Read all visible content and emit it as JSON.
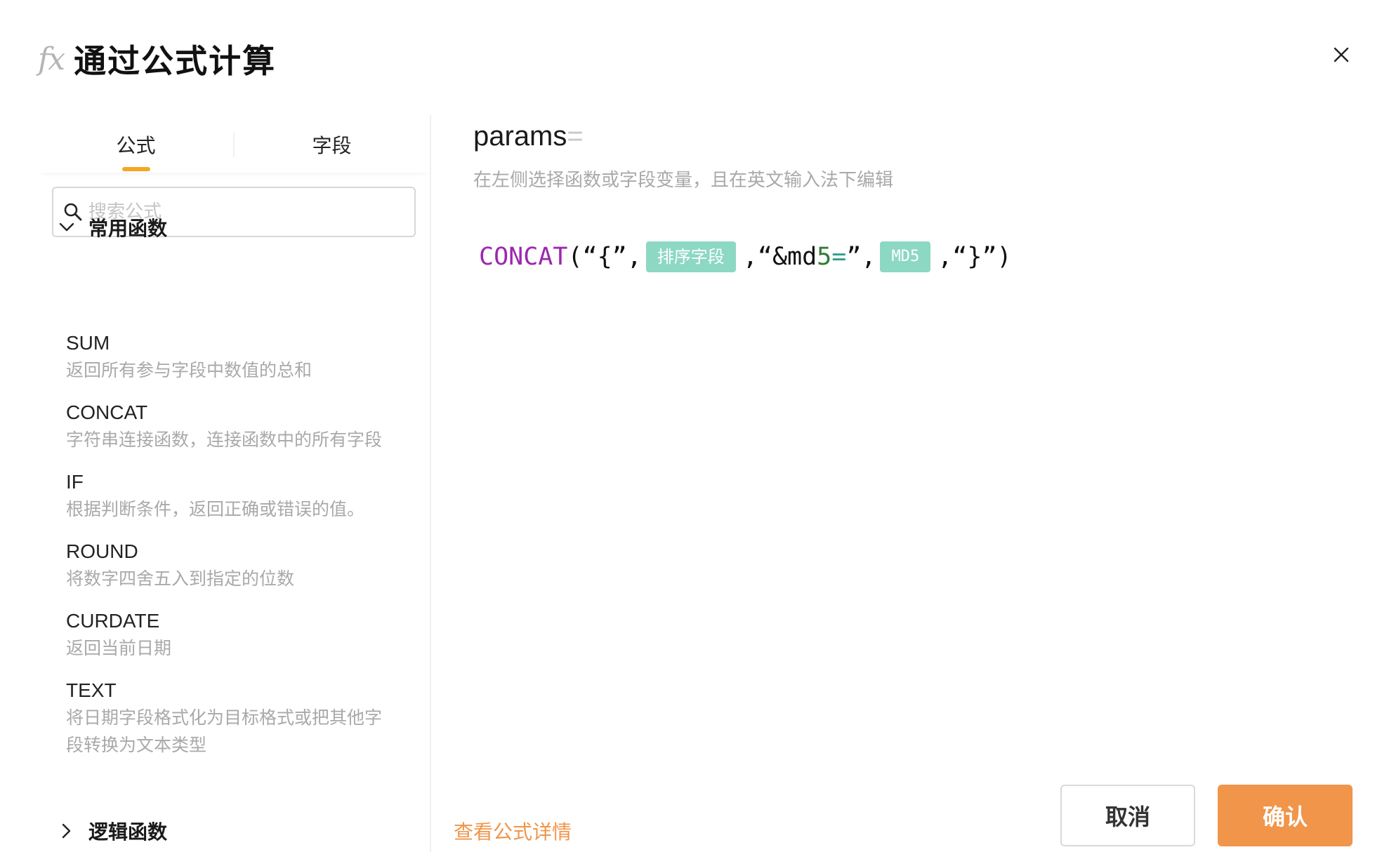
{
  "header": {
    "fx_glyph": "fx",
    "title": "通过公式计算",
    "close_icon": "close-icon"
  },
  "tabs": [
    {
      "label": "公式",
      "active": true
    },
    {
      "label": "字段",
      "active": false
    }
  ],
  "search": {
    "placeholder": "搜索公式",
    "value": ""
  },
  "groups": {
    "common": {
      "label": "常用函数",
      "expanded": true
    },
    "logic": {
      "label": "逻辑函数",
      "expanded": false
    }
  },
  "functions": [
    {
      "name": "SUM",
      "desc": [
        "返回所有参与字段中数值的总和"
      ]
    },
    {
      "name": "CONCAT",
      "desc": [
        "字符串连接函数，连接函数中的所有字段"
      ]
    },
    {
      "name": "IF",
      "desc": [
        "根据判断条件，返回正确或错误的值。"
      ]
    },
    {
      "name": "ROUND",
      "desc": [
        "将数字四舍五入到指定的位数"
      ]
    },
    {
      "name": "CURDATE",
      "desc": [
        "返回当前日期"
      ]
    },
    {
      "name": "TEXT",
      "desc": [
        "将日期字段格式化为目标格式或把其他字",
        "段转换为文本类型"
      ]
    }
  ],
  "editor": {
    "param_name": "params",
    "param_eq": "=",
    "hint": "在左侧选择函数或字段变量，且在英文输入法下编辑",
    "formula": {
      "fn": "CONCAT",
      "open": "(",
      "str1": "“{”,",
      "chip1": "排序字段",
      "str2a": ",“&md",
      "str2num": "5",
      "str2eq": "=",
      "str2b": "”,",
      "chip2": "MD5",
      "str3": ",“}”",
      "close": ")"
    }
  },
  "footer": {
    "detail_link": "查看公式详情",
    "cancel": "取消",
    "confirm": "确认"
  },
  "colors": {
    "accent": "#f0954a",
    "tab_indicator": "#f5a623",
    "chip": "#8dd8c2",
    "function": "#9c27b0"
  }
}
